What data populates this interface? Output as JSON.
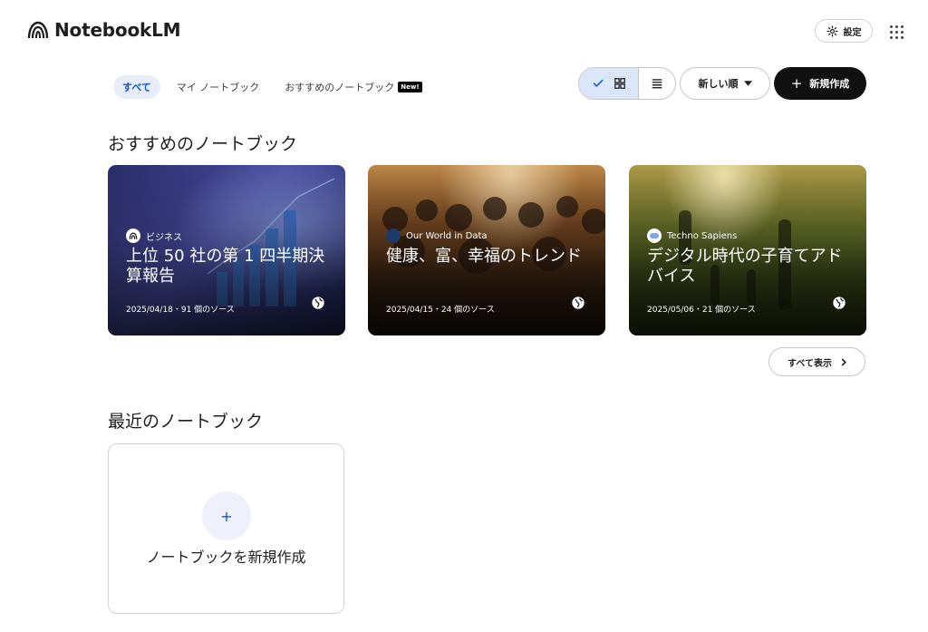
{
  "app": {
    "title": "NotebookLM"
  },
  "header": {
    "settings_label": "設定"
  },
  "filters": [
    {
      "label": "すべて"
    },
    {
      "label": "マイ ノートブック"
    },
    {
      "label": "おすすめのノートブック",
      "badge": "New!"
    }
  ],
  "toolbar": {
    "sort_label": "新しい順",
    "create_label": "新規作成",
    "selected_view": "grid"
  },
  "featured": {
    "heading": "おすすめのノートブック",
    "cards": [
      {
        "source": "ビジネス",
        "title": "上位 50 社の第 1 四半期決算報告",
        "meta": "2025/04/18・91 個のソース"
      },
      {
        "source": "Our World in Data",
        "title": "健康、富、幸福のトレンド",
        "meta": "2025/04/15・24 個のソース"
      },
      {
        "source": "Techno Sapiens",
        "title": "デジタル時代の子育てアドバイス",
        "meta": "2025/05/06・21 個のソース"
      }
    ],
    "show_all_label": "すべて表示"
  },
  "recent": {
    "heading": "最近のノートブック",
    "new_notebook_label": "ノートブックを新規作成"
  },
  "colors": {
    "accent": "#0b57d0",
    "active_filter_bg": "#e8edfb",
    "create_button_bg": "#111111"
  }
}
